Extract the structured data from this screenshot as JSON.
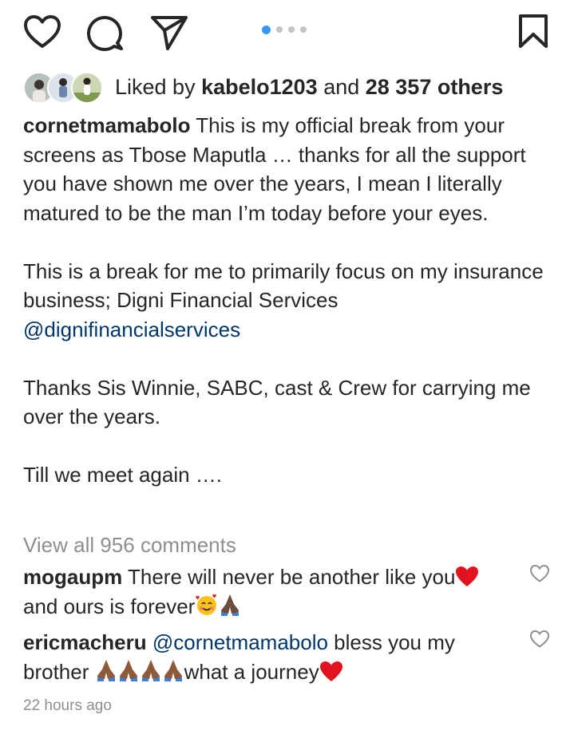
{
  "actions": {
    "like_icon": "heart-outline",
    "comment_icon": "speech-bubble",
    "share_icon": "paper-plane",
    "save_icon": "bookmark-outline"
  },
  "carousel": {
    "count": 4,
    "active": 0,
    "active_color": "#3897f0"
  },
  "likes": {
    "prefix": "Liked by ",
    "user": "kabelo1203",
    "middle": " and ",
    "count": "28 357 others"
  },
  "caption": {
    "username": "cornetmamabolo",
    "line1": " This is my official break from your screens as Tbose Maputla … thanks for all the support you have shown me over the years, I mean I literally matured to be the man I’m today before your eyes.",
    "para2": "This is a break for me to primarily focus on my insurance business; Digni Financial Services",
    "mention": "@dignifinancialservices",
    "para3": "Thanks Sis Winnie, SABC, cast & Crew for carrying me over the years.",
    "para4": "Till we meet again …."
  },
  "view_all": "View all 956 comments",
  "comments": [
    {
      "username": "mogaupm",
      "text1": " There will never be another like you",
      "text2": "and ours is forever"
    },
    {
      "username": "ericmacheru",
      "mention": "@cornetmamabolo",
      "text1": " bless you my",
      "text2a": "brother ",
      "text2b": "what a journey"
    }
  ],
  "timestamp": "22 hours ago"
}
